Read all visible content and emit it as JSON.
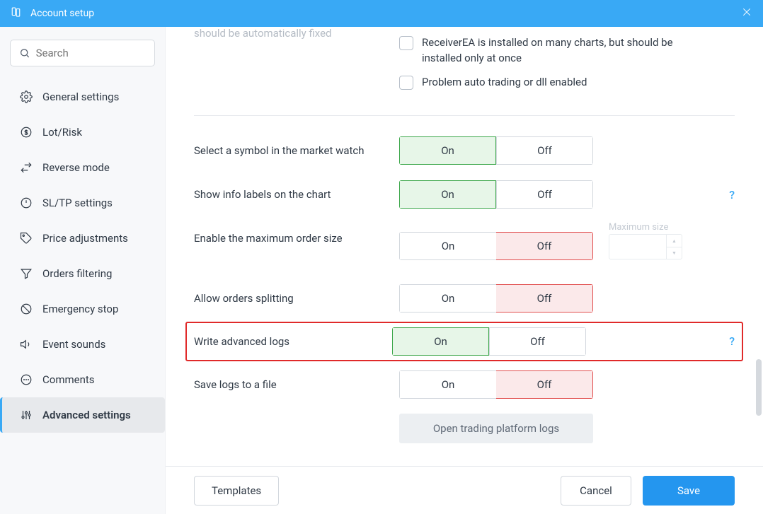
{
  "titlebar": {
    "title": "Account setup"
  },
  "sidebar": {
    "search_placeholder": "Search",
    "items": [
      {
        "id": "general",
        "label": "General settings"
      },
      {
        "id": "lotrisk",
        "label": "Lot/Risk"
      },
      {
        "id": "reverse",
        "label": "Reverse mode"
      },
      {
        "id": "sltp",
        "label": "SL/TP settings"
      },
      {
        "id": "priceadj",
        "label": "Price adjustments"
      },
      {
        "id": "ordersfilt",
        "label": "Orders filtering"
      },
      {
        "id": "emergency",
        "label": "Emergency stop"
      },
      {
        "id": "eventsounds",
        "label": "Event sounds"
      },
      {
        "id": "comments",
        "label": "Comments"
      },
      {
        "id": "advanced",
        "label": "Advanced settings"
      }
    ]
  },
  "content": {
    "truncated_line": "should be automatically fixed",
    "checks": [
      "ReceiverEA is installed on many charts, but should be installed only at once",
      "Problem auto trading or dll enabled"
    ],
    "toggle_on": "On",
    "toggle_off": "Off",
    "rows": {
      "select_symbol": "Select a symbol in the market watch",
      "info_labels": "Show info labels on the chart",
      "max_order_size": "Enable the maximum order size",
      "allow_splitting": "Allow orders splitting",
      "advanced_logs": "Write advanced logs",
      "save_logs": "Save logs to a file"
    },
    "max_size_label": "Maximum size",
    "open_logs_btn": "Open trading platform logs",
    "help": "?"
  },
  "footer": {
    "templates": "Templates",
    "cancel": "Cancel",
    "save": "Save"
  }
}
